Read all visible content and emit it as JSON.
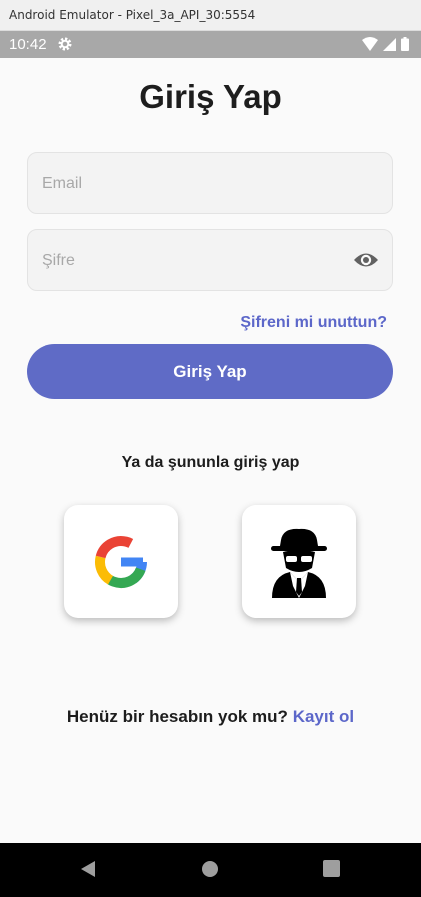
{
  "window": {
    "title": "Android Emulator - Pixel_3a_API_30:5554"
  },
  "status_bar": {
    "time": "10:42"
  },
  "page": {
    "title": "Giriş Yap",
    "email": {
      "placeholder": "Email",
      "value": ""
    },
    "password": {
      "placeholder": "Şifre",
      "value": ""
    },
    "forgot_password": "Şifreni mi unuttun?",
    "login_button": "Giriş Yap",
    "or_text": "Ya da şununla giriş yap",
    "no_account_text": "Henüz bir hesabın yok mu?",
    "signup_link": "Kayıt ol"
  },
  "icons": {
    "settings": "gear-icon",
    "wifi": "wifi-icon",
    "signal": "signal-icon",
    "battery": "battery-icon",
    "password_visibility": "eye-icon",
    "google": "google-icon",
    "anonymous": "spy-icon",
    "back": "back-icon",
    "home": "home-icon",
    "recents": "recents-icon"
  },
  "colors": {
    "primary": "#5f6bc6",
    "link": "#5c67c9",
    "text": "#1d1d1d",
    "background": "#fafafa"
  }
}
